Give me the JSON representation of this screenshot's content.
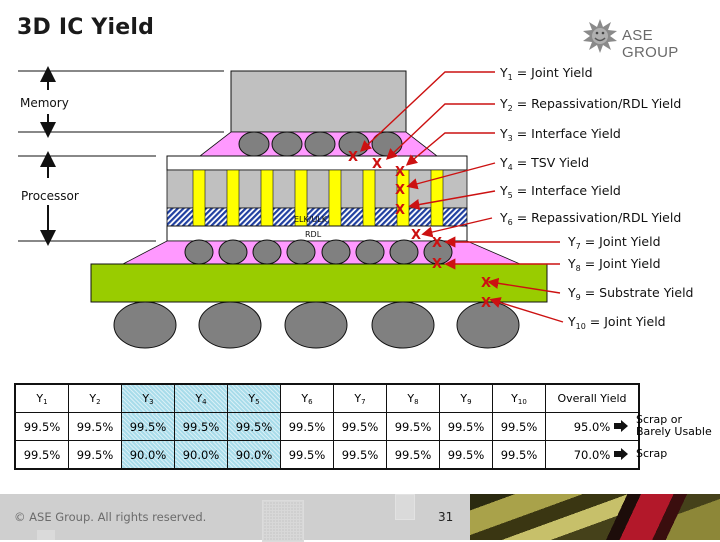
{
  "title": "3D IC Yield",
  "logo": {
    "icon": "sun-face-logo-icon",
    "text": "ASE GROUP"
  },
  "diagram": {
    "side_labels": {
      "memory": "Memory",
      "processor": "Processor"
    },
    "layer_labels": {
      "elk_ulk": "ELK/ULK",
      "rdl": "RDL"
    },
    "failure_marker": "X",
    "marker_color": "#cc1111",
    "yield_labels": [
      {
        "sym": "Y",
        "sub": "1",
        "text": " = Joint Yield"
      },
      {
        "sym": "Y",
        "sub": "2",
        "text": " = Repassivation/RDL Yield"
      },
      {
        "sym": "Y",
        "sub": "3",
        "text": " = Interface Yield"
      },
      {
        "sym": "Y",
        "sub": "4",
        "text": " = TSV Yield"
      },
      {
        "sym": "Y",
        "sub": "5",
        "text": " = Interface Yield"
      },
      {
        "sym": "Y",
        "sub": "6",
        "text": " = Repassivation/RDL Yield"
      },
      {
        "sym": "Y",
        "sub": "7",
        "text": " = Joint Yield"
      },
      {
        "sym": "Y",
        "sub": "8",
        "text": " = Joint Yield"
      },
      {
        "sym": "Y",
        "sub": "9",
        "text": " = Substrate Yield"
      },
      {
        "sym": "Y",
        "sub": "10",
        "text": " = Joint Yield"
      }
    ],
    "colors": {
      "die": "#c0c0c0",
      "underfill": "#ff99ff",
      "bump": "#808080",
      "tsv": "#ffff00",
      "dielectric": "#1f3fa0",
      "substrate": "#99cc00"
    }
  },
  "table": {
    "headers": [
      {
        "sym": "Y",
        "sub": "1"
      },
      {
        "sym": "Y",
        "sub": "2"
      },
      {
        "sym": "Y",
        "sub": "3"
      },
      {
        "sym": "Y",
        "sub": "4"
      },
      {
        "sym": "Y",
        "sub": "5"
      },
      {
        "sym": "Y",
        "sub": "6"
      },
      {
        "sym": "Y",
        "sub": "7"
      },
      {
        "sym": "Y",
        "sub": "8"
      },
      {
        "sym": "Y",
        "sub": "9"
      },
      {
        "sym": "Y",
        "sub": "10"
      }
    ],
    "overall_header": "Overall Yield",
    "highlighted_columns": [
      "Y3",
      "Y4",
      "Y5"
    ],
    "rows": [
      {
        "values": [
          "99.5%",
          "99.5%",
          "99.5%",
          "99.5%",
          "99.5%",
          "99.5%",
          "99.5%",
          "99.5%",
          "99.5%",
          "99.5%"
        ],
        "overall": "95.0%",
        "verdict": "Scrap or Barely Usable"
      },
      {
        "values": [
          "99.5%",
          "99.5%",
          "90.0%",
          "90.0%",
          "90.0%",
          "99.5%",
          "99.5%",
          "99.5%",
          "99.5%",
          "99.5%"
        ],
        "overall": "70.0%",
        "verdict": "Scrap"
      }
    ]
  },
  "footer": {
    "copyright": "© ASE Group. All rights reserved.",
    "page_number": "31"
  }
}
